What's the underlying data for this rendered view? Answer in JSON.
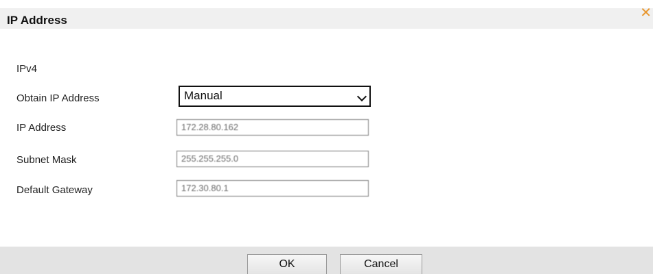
{
  "dialog": {
    "title": "IP Address",
    "close_icon": "close-icon",
    "accent_color": "#e8962d"
  },
  "section": {
    "title": "IPv4"
  },
  "form": {
    "obtain_label": "Obtain IP Address",
    "obtain_value": "Manual",
    "ip_label": "IP Address",
    "ip_value": "172.28.80.162",
    "mask_label": "Subnet Mask",
    "mask_value": "255.255.255.0",
    "gateway_label": "Default Gateway",
    "gateway_value": "172.30.80.1"
  },
  "footer": {
    "ok_label": "OK",
    "cancel_label": "Cancel"
  }
}
